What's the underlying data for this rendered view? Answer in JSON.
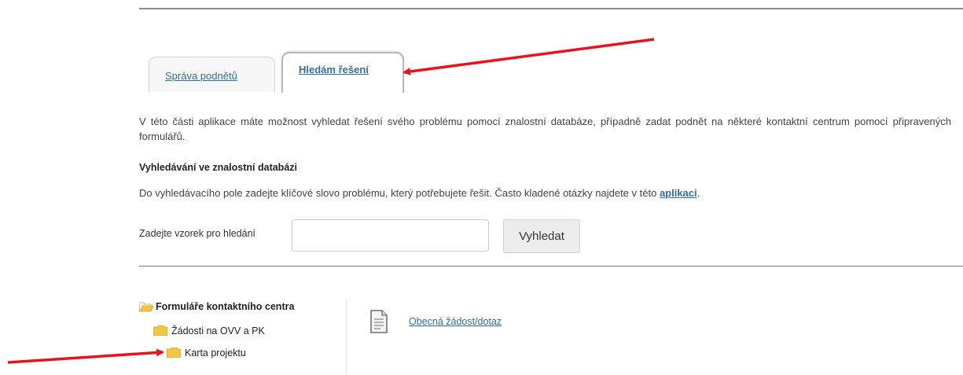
{
  "tabs": [
    {
      "label": "Správa podnětů",
      "active": false
    },
    {
      "label": "Hledám řešení",
      "active": true
    }
  ],
  "intro_text": "V této části aplikace máte možnost vyhledat řešení svého problému pomocí znalostní databáze, případně zadat podnět na některé kontaktní centrum pomocí připravených formulářů.",
  "search_section": {
    "heading": "Vyhledávání ve znalostní databázi",
    "help_prefix": "Do vyhledávacího pole zadejte klíčové slovo problému, který potřebujete řešit. Často kladené otázky najdete v této ",
    "help_link": "aplikaci",
    "help_suffix": ".",
    "input_label": "Zadejte vzorek pro hledání",
    "input_value": "",
    "button_label": "Vyhledat"
  },
  "tree": {
    "root": "Formuláře kontaktního centra",
    "items": [
      {
        "label": "Žádosti na OVV a PK",
        "level": 1
      },
      {
        "label": "Karta projektu",
        "level": 2
      }
    ]
  },
  "documents": [
    {
      "label": "Obecná žádost/dotaz",
      "icon": "document-icon"
    }
  ],
  "colors": {
    "link": "#2f6fa3",
    "annotation_arrow": "#e8141b",
    "folder": "#f2c744"
  }
}
